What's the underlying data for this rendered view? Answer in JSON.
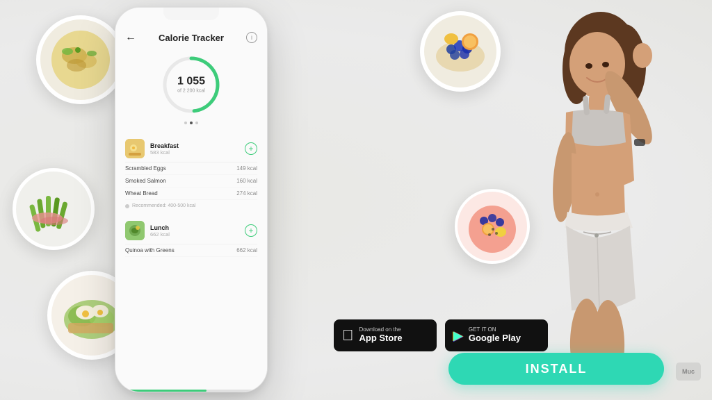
{
  "app": {
    "title": "Calorie Tracker",
    "bg_color": "#eeeeea"
  },
  "phone": {
    "title": "Calorie Tracker",
    "back_label": "←",
    "info_label": "i",
    "calorie_number": "1 055",
    "calorie_sub": "of 2 200 kcal",
    "calorie_progress": 48,
    "meals": [
      {
        "name": "Breakfast",
        "kcal_label": "583 kcal",
        "items": [
          {
            "name": "Scrambled Eggs",
            "kcal": "149 kcal"
          },
          {
            "name": "Smoked Salmon",
            "kcal": "160 kcal"
          },
          {
            "name": "Wheat Bread",
            "kcal": "274 kcal"
          }
        ]
      },
      {
        "name": "Lunch",
        "kcal_label": "662 kcal",
        "items": [
          {
            "name": "Quinoa with Greens",
            "kcal": "662 kcal"
          }
        ]
      }
    ],
    "recommended": "Recommended: 400-500 kcal"
  },
  "store_buttons": {
    "appstore": {
      "top_text": "Download on the",
      "main_text": "App Store",
      "icon": ""
    },
    "googleplay": {
      "top_text": "GET IT ON",
      "main_text": "Google Play",
      "icon": "▶"
    }
  },
  "install_button": {
    "label": "INSTALL"
  },
  "corner_badge": {
    "label": "Muc"
  }
}
